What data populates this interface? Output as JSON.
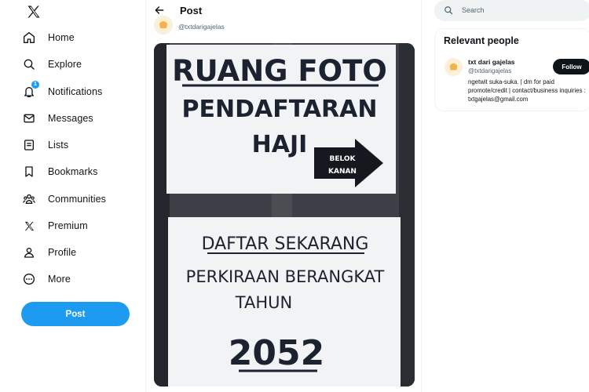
{
  "nav": {
    "items": [
      {
        "label": "Home",
        "icon": "home-icon"
      },
      {
        "label": "Explore",
        "icon": "search-icon"
      },
      {
        "label": "Notifications",
        "icon": "bell-icon",
        "badge": "1"
      },
      {
        "label": "Messages",
        "icon": "envelope-icon"
      },
      {
        "label": "Lists",
        "icon": "list-icon"
      },
      {
        "label": "Bookmarks",
        "icon": "bookmark-icon"
      },
      {
        "label": "Communities",
        "icon": "people-icon"
      },
      {
        "label": "Premium",
        "icon": "x-logo-icon"
      },
      {
        "label": "Profile",
        "icon": "person-icon"
      },
      {
        "label": "More",
        "icon": "more-circle-icon"
      }
    ],
    "post_label": "Post"
  },
  "main": {
    "title": "Post",
    "handle": "@txtdarigajelas",
    "photo": {
      "sign1_title": "RUANG FOTO",
      "sign1_line2": "PENDAFTARAN",
      "sign1_line3": "HAJI",
      "arrow_line1": "BELOK",
      "arrow_line2": "KANAN",
      "sign2_line1": "DAFTAR SEKARANG",
      "sign2_line2": "PERKIRAAN BERANGKAT",
      "sign2_line3": "TAHUN",
      "sign2_year": "2052"
    }
  },
  "right": {
    "search_placeholder": "Search",
    "relevant_title": "Relevant people",
    "person": {
      "name": "txt dari gajelas",
      "handle": "@txtdarigajelas",
      "follow_label": "Follow",
      "bio": "ngetwit suka-suka. | dm for paid promote/credit | contact/business inquiries : txtgajelas@gmail.com"
    }
  },
  "colors": {
    "accent": "#1d9bf0",
    "text": "#0f1419",
    "muted": "#536471"
  }
}
